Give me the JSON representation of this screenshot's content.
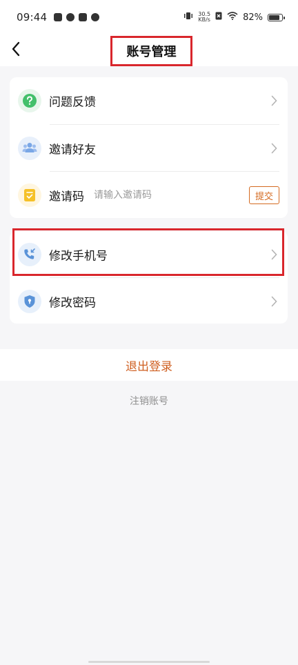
{
  "status_bar": {
    "time": "09:44",
    "net_speed_value": "30.5",
    "net_speed_unit": "KB/s",
    "battery_percent": "82%",
    "battery_level": 0.82
  },
  "header": {
    "title": "账号管理"
  },
  "menu_group_1": {
    "items": [
      {
        "label": "问题反馈",
        "icon": "question-icon",
        "icon_bg": "#e8f6ec",
        "icon_color": "#43c06b"
      },
      {
        "label": "邀请好友",
        "icon": "friends-icon",
        "icon_bg": "#e8f0fb",
        "icon_color": "#7aa7e6"
      },
      {
        "label": "邀请码",
        "icon": "invite-code-icon",
        "icon_bg": "#fff6e0",
        "icon_color": "#f5c128"
      }
    ],
    "invite_placeholder": "请输入邀请码",
    "submit_label": "提交"
  },
  "menu_group_2": {
    "items": [
      {
        "label": "修改手机号",
        "icon": "phone-icon",
        "icon_bg": "#e7f0fb",
        "icon_color": "#5a93d8"
      },
      {
        "label": "修改密码",
        "icon": "shield-lock-icon",
        "icon_bg": "#e7f0fb",
        "icon_color": "#5a93d8"
      }
    ]
  },
  "logout_label": "退出登录",
  "cancel_account_label": "注销账号",
  "colors": {
    "accent": "#cf5f21",
    "highlight": "#d9262c",
    "background": "#f6f6f8"
  }
}
